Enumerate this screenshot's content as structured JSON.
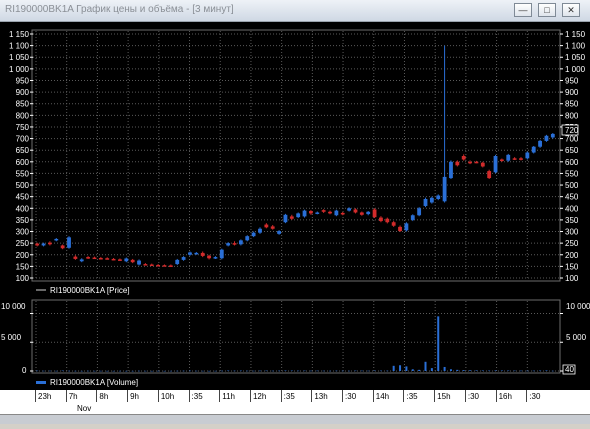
{
  "window": {
    "title": "RI190000BK1A График цены и объёма - [3 минут]",
    "minimize_icon": "minimize-icon",
    "restore_icon": "restore-icon",
    "close_icon": "close-icon"
  },
  "colors": {
    "background": "#000000",
    "up_candle": "#2a6fd6",
    "down_candle": "#d22b2b",
    "volume": "#2a6fd6",
    "grid": "#5a5a5a"
  },
  "price_panel": {
    "y_ticks": [
      "1 150",
      "1 100",
      "1 050",
      "1 000",
      "950",
      "900",
      "850",
      "800",
      "750",
      "700",
      "650",
      "600",
      "550",
      "500",
      "450",
      "400",
      "350",
      "300",
      "250",
      "200",
      "150",
      "100"
    ],
    "legend": "RI190000BK1A [Price]",
    "last_price_tag": "720"
  },
  "volume_panel": {
    "y_ticks_left": [
      "10 000",
      "5 000",
      "0"
    ],
    "y_ticks_right": [
      "10 000",
      "5 000"
    ],
    "legend": "RI190000BK1A [Volume]",
    "last_volume_tag": "40"
  },
  "time_axis": {
    "labels": [
      "23h",
      "7h",
      "8h",
      "9h",
      "10h",
      ":35",
      "11h",
      "12h",
      ":35",
      "13h",
      ":30",
      "14h",
      ":35",
      "15h",
      ":30",
      "16h",
      ":30"
    ],
    "date_labels": [
      "Nov"
    ]
  },
  "chart_data": [
    {
      "type": "candlestick",
      "title": "RI190000BK1A [Price]",
      "ylim": [
        100,
        1150
      ],
      "grid": true,
      "x_time_labels": [
        "23h",
        "7h",
        "8h",
        "9h",
        "10h",
        ":35",
        "11h",
        "12h",
        ":35",
        "13h",
        ":30",
        "14h",
        ":35",
        "15h",
        ":30",
        "16h",
        ":30"
      ],
      "candles": [
        {
          "o": 248,
          "c": 240,
          "h": 252,
          "l": 236
        },
        {
          "o": 240,
          "c": 248,
          "h": 252,
          "l": 236
        },
        {
          "o": 252,
          "c": 245,
          "h": 258,
          "l": 240
        },
        {
          "o": 262,
          "c": 268,
          "h": 272,
          "l": 258
        },
        {
          "o": 240,
          "c": 228,
          "h": 244,
          "l": 224
        },
        {
          "o": 230,
          "c": 275,
          "h": 280,
          "l": 226
        },
        {
          "o": 192,
          "c": 182,
          "h": 198,
          "l": 178
        },
        {
          "o": 172,
          "c": 180,
          "h": 185,
          "l": 168
        },
        {
          "o": 190,
          "c": 186,
          "h": 194,
          "l": 182
        },
        {
          "o": 188,
          "c": 185,
          "h": 192,
          "l": 182
        },
        {
          "o": 186,
          "c": 184,
          "h": 190,
          "l": 180
        },
        {
          "o": 185,
          "c": 183,
          "h": 189,
          "l": 180
        },
        {
          "o": 182,
          "c": 180,
          "h": 186,
          "l": 176
        },
        {
          "o": 180,
          "c": 178,
          "h": 184,
          "l": 174
        },
        {
          "o": 172,
          "c": 184,
          "h": 188,
          "l": 168
        },
        {
          "o": 178,
          "c": 168,
          "h": 182,
          "l": 164
        },
        {
          "o": 158,
          "c": 175,
          "h": 180,
          "l": 154
        },
        {
          "o": 160,
          "c": 158,
          "h": 164,
          "l": 154
        },
        {
          "o": 158,
          "c": 156,
          "h": 162,
          "l": 152
        },
        {
          "o": 156,
          "c": 154,
          "h": 160,
          "l": 150
        },
        {
          "o": 155,
          "c": 153,
          "h": 158,
          "l": 150
        },
        {
          "o": 154,
          "c": 152,
          "h": 158,
          "l": 148
        },
        {
          "o": 160,
          "c": 178,
          "h": 182,
          "l": 156
        },
        {
          "o": 178,
          "c": 190,
          "h": 194,
          "l": 174
        },
        {
          "o": 200,
          "c": 210,
          "h": 214,
          "l": 196
        },
        {
          "o": 205,
          "c": 208,
          "h": 212,
          "l": 200
        },
        {
          "o": 208,
          "c": 195,
          "h": 214,
          "l": 190
        },
        {
          "o": 196,
          "c": 185,
          "h": 200,
          "l": 180
        },
        {
          "o": 186,
          "c": 190,
          "h": 194,
          "l": 182
        },
        {
          "o": 185,
          "c": 222,
          "h": 226,
          "l": 180
        },
        {
          "o": 240,
          "c": 250,
          "h": 254,
          "l": 236
        },
        {
          "o": 250,
          "c": 245,
          "h": 258,
          "l": 240
        },
        {
          "o": 245,
          "c": 262,
          "h": 266,
          "l": 240
        },
        {
          "o": 262,
          "c": 280,
          "h": 284,
          "l": 258
        },
        {
          "o": 280,
          "c": 295,
          "h": 300,
          "l": 276
        },
        {
          "o": 295,
          "c": 312,
          "h": 318,
          "l": 290
        },
        {
          "o": 330,
          "c": 318,
          "h": 336,
          "l": 314
        },
        {
          "o": 322,
          "c": 312,
          "h": 328,
          "l": 308
        },
        {
          "o": 290,
          "c": 302,
          "h": 306,
          "l": 286
        },
        {
          "o": 340,
          "c": 372,
          "h": 376,
          "l": 336
        },
        {
          "o": 365,
          "c": 355,
          "h": 372,
          "l": 350
        },
        {
          "o": 362,
          "c": 378,
          "h": 382,
          "l": 358
        },
        {
          "o": 365,
          "c": 390,
          "h": 394,
          "l": 360
        },
        {
          "o": 388,
          "c": 378,
          "h": 392,
          "l": 372
        },
        {
          "o": 378,
          "c": 382,
          "h": 386,
          "l": 374
        },
        {
          "o": 392,
          "c": 385,
          "h": 396,
          "l": 380
        },
        {
          "o": 385,
          "c": 378,
          "h": 390,
          "l": 374
        },
        {
          "o": 370,
          "c": 390,
          "h": 394,
          "l": 366
        },
        {
          "o": 380,
          "c": 375,
          "h": 384,
          "l": 370
        },
        {
          "o": 390,
          "c": 400,
          "h": 404,
          "l": 386
        },
        {
          "o": 395,
          "c": 382,
          "h": 400,
          "l": 378
        },
        {
          "o": 382,
          "c": 372,
          "h": 386,
          "l": 368
        },
        {
          "o": 375,
          "c": 385,
          "h": 388,
          "l": 370
        },
        {
          "o": 395,
          "c": 362,
          "h": 400,
          "l": 358
        },
        {
          "o": 360,
          "c": 345,
          "h": 366,
          "l": 340
        },
        {
          "o": 355,
          "c": 340,
          "h": 360,
          "l": 335
        },
        {
          "o": 340,
          "c": 325,
          "h": 345,
          "l": 320
        },
        {
          "o": 320,
          "c": 302,
          "h": 326,
          "l": 298
        },
        {
          "o": 305,
          "c": 335,
          "h": 340,
          "l": 300
        },
        {
          "o": 350,
          "c": 370,
          "h": 374,
          "l": 345
        },
        {
          "o": 370,
          "c": 400,
          "h": 405,
          "l": 366
        },
        {
          "o": 410,
          "c": 440,
          "h": 446,
          "l": 405
        },
        {
          "o": 425,
          "c": 445,
          "h": 450,
          "l": 420
        },
        {
          "o": 440,
          "c": 455,
          "h": 460,
          "l": 435
        },
        {
          "o": 430,
          "c": 535,
          "h": 1100,
          "l": 425
        },
        {
          "o": 530,
          "c": 600,
          "h": 606,
          "l": 526
        },
        {
          "o": 600,
          "c": 585,
          "h": 606,
          "l": 580
        },
        {
          "o": 625,
          "c": 610,
          "h": 632,
          "l": 605
        },
        {
          "o": 600,
          "c": 595,
          "h": 606,
          "l": 590
        },
        {
          "o": 600,
          "c": 598,
          "h": 604,
          "l": 594
        },
        {
          "o": 596,
          "c": 580,
          "h": 600,
          "l": 576
        },
        {
          "o": 560,
          "c": 530,
          "h": 566,
          "l": 526
        },
        {
          "o": 555,
          "c": 625,
          "h": 630,
          "l": 550
        },
        {
          "o": 610,
          "c": 605,
          "h": 614,
          "l": 600
        },
        {
          "o": 605,
          "c": 630,
          "h": 634,
          "l": 600
        },
        {
          "o": 615,
          "c": 612,
          "h": 620,
          "l": 608
        },
        {
          "o": 615,
          "c": 610,
          "h": 620,
          "l": 606
        },
        {
          "o": 615,
          "c": 640,
          "h": 644,
          "l": 610
        },
        {
          "o": 640,
          "c": 665,
          "h": 668,
          "l": 636
        },
        {
          "o": 665,
          "c": 690,
          "h": 694,
          "l": 660
        },
        {
          "o": 690,
          "c": 712,
          "h": 716,
          "l": 686
        },
        {
          "o": 705,
          "c": 720,
          "h": 724,
          "l": 700
        }
      ]
    },
    {
      "type": "bar",
      "title": "RI190000BK1A [Volume]",
      "ylim": [
        0,
        12000
      ],
      "values": [
        60,
        40,
        50,
        30,
        80,
        40,
        30,
        20,
        40,
        30,
        30,
        20,
        20,
        30,
        20,
        20,
        40,
        30,
        20,
        30,
        20,
        30,
        40,
        50,
        60,
        40,
        30,
        20,
        30,
        50,
        80,
        60,
        70,
        50,
        40,
        60,
        70,
        50,
        60,
        90,
        80,
        60,
        70,
        50,
        60,
        50,
        40,
        60,
        50,
        40,
        70,
        60,
        50,
        80,
        70,
        60,
        900,
        1000,
        800,
        300,
        200,
        1600,
        500,
        9500,
        700,
        300,
        200,
        150,
        120,
        100,
        90,
        80,
        100,
        90,
        80,
        70,
        60,
        50,
        60,
        80,
        100,
        40
      ]
    }
  ]
}
